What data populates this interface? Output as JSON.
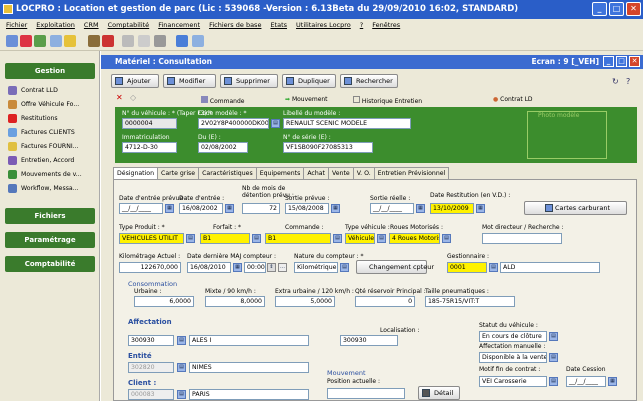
{
  "window": {
    "title": "LOCPRO : Location et gestion de parc (Lic : 539068 -Version : 6.13Beta du 29/09/2010 16:02, STANDARD)"
  },
  "menu": [
    "Fichier",
    "Exploitation",
    "CRM",
    "Comptabilité",
    "Financement",
    "Fichiers de base",
    "Etats",
    "Utilitaires Locpro",
    "?",
    "Fenêtres"
  ],
  "sidebar": {
    "gestion": "Gestion",
    "items": [
      "Contrat LLD",
      "Offre Véhicule Fo...",
      "Restitutions",
      "Factures CLIENTS",
      "Factures FOURNI...",
      "Entretien, Accord",
      "Mouvements de v...",
      "Workflow, Messa..."
    ],
    "fichiers": "Fichiers",
    "parametrage": "Paramétrage",
    "comptabilite": "Comptabilité"
  },
  "form": {
    "title": "Matériel : Consultation",
    "ecran": "Ecran : 9 [_VEH]",
    "buttons": {
      "ajouter": "Ajouter",
      "modifier": "Modifier",
      "supprimer": "Supprimer",
      "dupliquer": "Dupliquer",
      "rechercher": "Rechercher"
    },
    "links": {
      "commande": "Commande",
      "mouvement": "Mouvement",
      "historique": "Historique Entretien",
      "contrat": "Contrat LD"
    }
  },
  "header": {
    "num_label": "N° du véhicule : * (Taper F3) *",
    "num": "0000004",
    "modele_label": "Code modèle : *",
    "modele": "2V02Y8P400000DK00",
    "libelle_label": "Libellé du modèle :",
    "libelle": "RENAULT SCENIC MODELE",
    "photo": "Photo modèle",
    "immat_label": "Immatriculation",
    "immat": "4712-D-30",
    "du_label": "Du (E) :",
    "du": "02/08/2002",
    "serie_label": "N° de série (E) :",
    "serie": "VF1SB090F27085313"
  },
  "tabs": [
    "Désignation",
    "Carte grise",
    "Caractéristiques",
    "Equipements",
    "Achat",
    "Vente",
    "V. O.",
    "Entretien Prévisionnel"
  ],
  "designation": {
    "date_entree_prevue_label": "Date d'entrée prévue :",
    "date_entree_prevue": "__/__/____",
    "date_entree_label": "Date d'entrée :",
    "date_entree": "16/08/2002",
    "nb_mois_label1": "Nb de mois de",
    "nb_mois_label2": "détention prévu :",
    "nb_mois": "72",
    "sortie_prevue_label": "Sortie prévue :",
    "sortie_prevue": "15/08/2008",
    "sortie_reelle_label": "Sortie réelle :",
    "sortie_reelle": "__/__/____",
    "restitution_label": "Date Restitution (en V.D.) :",
    "restitution": "13/10/2009",
    "cartes_carburant": "Cartes carburant",
    "type_produit_label": "Type Produit : *",
    "type_produit": "VEHICULES UTILIT",
    "forfait_label": "Forfait : *",
    "forfait": "B1",
    "commande_label": "Commande :",
    "commande": "B1",
    "type_vehicule_label": "Type véhicule :",
    "type_vehicule": "Véhicules d'Ex",
    "roues_label": "Roues Motorisés :",
    "roues": "4 Roues Motorisés",
    "mot_directeur_label": "Mot directeur / Recherche :",
    "mot_directeur": "",
    "km_label": "Kilométrage Actuel :",
    "km": "122670,000",
    "maj_label": "Date dernière MAJ compteur :",
    "maj_date": "16/08/2010",
    "maj_time": "00:00",
    "nature_label": "Nature du compteur : *",
    "nature": "Kilométrique",
    "changement": "Changement cpteur",
    "gestionnaire_label": "Gestionnaire :",
    "gestionnaire_code": "0001",
    "gestionnaire": "ALD",
    "conso_title": "Consommation",
    "urbaine_label": "Urbaine :",
    "urbaine": "6,0000",
    "mixte_label": "Mixte / 90 km/h :",
    "mixte": "8,0000",
    "extra_label": "Extra urbaine / 120 km/h :",
    "extra": "5,0000",
    "reservoir_label": "Qté réservoir Principal :",
    "reservoir": "0",
    "pneu_label": "Taille pneumatiques :",
    "pneu": "185-75R15/VIT:T"
  },
  "affectation": {
    "title": "Affectation",
    "code": "300930",
    "ville": "ALES I",
    "localisation_label": "Localisation :",
    "localisation": "300930",
    "entite_label": "Entité",
    "entite_code": "302820",
    "entite": "NIMES",
    "client_label": "Client :",
    "client_code": "000083",
    "client": "PARIS"
  },
  "statut": {
    "statut_label": "Statut du véhicule :",
    "statut": "En cours de clôture",
    "affect_manuelle_label": "Affectation manuelle :",
    "affect_manuelle": "Disponible à la vente",
    "motif_label": "Motif fin de contrat :",
    "motif": "VEI Carosserie",
    "date_cession_label": "Date Cession",
    "date_cession": "__/__/____"
  },
  "mouvement": {
    "title": "Mouvement",
    "position_label": "Position actuelle :",
    "detail": "Détail"
  }
}
